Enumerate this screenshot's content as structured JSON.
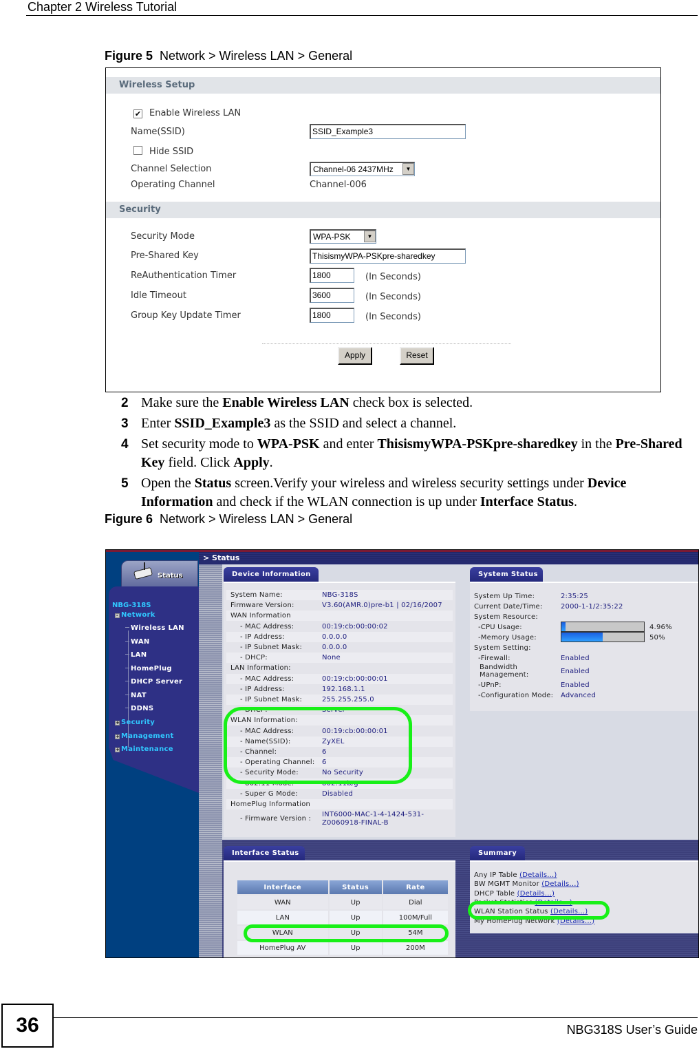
{
  "page": {
    "chapter_header": "Chapter 2 Wireless Tutorial",
    "page_number": "36",
    "guide_title": "NBG318S User’s Guide"
  },
  "figure5": {
    "caption_label": "Figure 5",
    "caption_text": "Network > Wireless LAN > General",
    "wireless_setup": {
      "title": "Wireless Setup",
      "enable_wlan_label": "Enable Wireless LAN",
      "enable_wlan_checked": true,
      "ssid_label": "Name(SSID)",
      "ssid_value": "SSID_Example3",
      "hide_ssid_label": "Hide SSID",
      "hide_ssid_checked": false,
      "channel_selection_label": "Channel Selection",
      "channel_selection_value": "Channel-06 2437MHz",
      "operating_channel_label": "Operating Channel",
      "operating_channel_value": "Channel-006"
    },
    "security": {
      "title": "Security",
      "mode_label": "Security Mode",
      "mode_value": "WPA-PSK",
      "psk_label": "Pre-Shared Key",
      "psk_value": "ThisismyWPA-PSKpre-sharedkey",
      "reauth_label": "ReAuthentication Timer",
      "reauth_value": "1800",
      "idle_label": "Idle Timeout",
      "idle_value": "3600",
      "group_key_label": "Group Key Update Timer",
      "group_key_value": "1800",
      "unit": "(In Seconds)"
    },
    "buttons": {
      "apply": "Apply",
      "reset": "Reset"
    }
  },
  "steps": [
    {
      "num": "2",
      "parts": [
        "Make sure the ",
        {
          "b": "Enable Wireless LAN"
        },
        " check box is selected."
      ]
    },
    {
      "num": "3",
      "parts": [
        "Enter ",
        {
          "b": "SSID_Example3"
        },
        " as the SSID and select a channel."
      ]
    },
    {
      "num": "4",
      "parts": [
        "Set security mode to ",
        {
          "b": "WPA-PSK"
        },
        " and enter ",
        {
          "b": "ThisismyWPA-PSKpre-sharedkey"
        },
        " in the ",
        {
          "b": "Pre-Shared Key"
        },
        " field. Click ",
        {
          "b": "Apply"
        },
        "."
      ]
    },
    {
      "num": "5",
      "parts": [
        "Open the ",
        {
          "b": "Status"
        },
        " screen.Verify your wireless and wireless security settings under ",
        {
          "b": "Device Information"
        },
        " and check if the WLAN connection is up under ",
        {
          "b": "Interface Status"
        },
        "."
      ]
    }
  ],
  "figure6": {
    "caption_label": "Figure 6",
    "caption_text": "Network > Wireless LAN > General",
    "breadcrumb": "Status",
    "status_tab": "Status",
    "sidebar": {
      "model": "NBG-318S",
      "network": "Network",
      "network_items": [
        "Wireless LAN",
        "WAN",
        "LAN",
        "HomePlug",
        "DHCP Server",
        "NAT",
        "DDNS"
      ],
      "other_items": [
        "Security",
        "Management",
        "Maintenance"
      ]
    },
    "device_info": {
      "title": "Device Information",
      "rows": [
        {
          "k": "System Name:",
          "v": "NBG-318S",
          "indent": false
        },
        {
          "k": "Firmware Version:",
          "v": "V3.60(AMR.0)pre-b1 | 02/16/2007",
          "indent": false
        },
        {
          "k": "WAN Information",
          "v": "",
          "indent": false
        },
        {
          "k": "- MAC Address:",
          "v": "00:19:cb:00:00:02",
          "indent": true
        },
        {
          "k": "- IP Address:",
          "v": "0.0.0.0",
          "indent": true
        },
        {
          "k": "- IP Subnet Mask:",
          "v": "0.0.0.0",
          "indent": true
        },
        {
          "k": "- DHCP:",
          "v": "None",
          "indent": true
        },
        {
          "k": "LAN Information:",
          "v": "",
          "indent": false
        },
        {
          "k": "- MAC Address:",
          "v": "00:19:cb:00:00:01",
          "indent": true
        },
        {
          "k": "- IP Address:",
          "v": "192.168.1.1",
          "indent": true
        },
        {
          "k": "- IP Subnet Mask:",
          "v": "255.255.255.0",
          "indent": true
        },
        {
          "k": "- DHCP:",
          "v": "Server",
          "indent": true
        },
        {
          "k": "WLAN Information:",
          "v": "",
          "indent": false
        },
        {
          "k": "- MAC Address:",
          "v": "00:19:cb:00:00:01",
          "indent": true
        },
        {
          "k": "- Name(SSID):",
          "v": "ZyXEL",
          "indent": true
        },
        {
          "k": "- Channel:",
          "v": "6",
          "indent": true
        },
        {
          "k": "- Operating Channel:",
          "v": "6",
          "indent": true
        },
        {
          "k": "- Security Mode:",
          "v": "No Security",
          "indent": true
        },
        {
          "k": "- 802.11 Mode:",
          "v": "802.11b/g",
          "indent": true
        },
        {
          "k": "- Super G Mode:",
          "v": "Disabled",
          "indent": true
        },
        {
          "k": "HomePlug Information",
          "v": "",
          "indent": false
        },
        {
          "k": "- Firmware Version :",
          "v": "INT6000-MAC-1-4-1424-531-",
          "v2": "Z0060918-FINAL-B",
          "indent": true
        }
      ]
    },
    "system_status": {
      "title": "System Status",
      "up_time_label": "System Up Time:",
      "up_time": "2:35:25",
      "datetime_label": "Current Date/Time:",
      "datetime": "2000-1-1/2:35:22",
      "resource_label": "System Resource:",
      "cpu_label": "-CPU Usage:",
      "cpu_value": "4.96%",
      "cpu_fraction": 0.0496,
      "mem_label": "-Memory Usage:",
      "mem_value": "50%",
      "mem_fraction": 0.5,
      "setting_label": "System Setting:",
      "firewall_label": "-Firewall:",
      "firewall": "Enabled",
      "bw_label_1": "Bandwidth",
      "bw_label_2": "Management:",
      "bw": "Enabled",
      "upnp_label": "-UPnP:",
      "upnp": "Enabled",
      "config_label": "-Configuration Mode:",
      "config": "Advanced"
    },
    "interface_status": {
      "title": "Interface Status",
      "headers": [
        "Interface",
        "Status",
        "Rate"
      ],
      "rows": [
        [
          "WAN",
          "Up",
          "Dial"
        ],
        [
          "LAN",
          "Up",
          "100M/Full"
        ],
        [
          "WLAN",
          "Up",
          "54M"
        ],
        [
          "HomePlug AV",
          "Up",
          "200M"
        ]
      ]
    },
    "summary": {
      "title": "Summary",
      "link_text": "(Details...)",
      "items": [
        "Any IP Table",
        "BW MGMT Monitor",
        "DHCP Table",
        "Packet Statistics",
        "WLAN Station Status",
        "My HomePlug Network"
      ]
    },
    "highlight_color": "#18f018"
  }
}
